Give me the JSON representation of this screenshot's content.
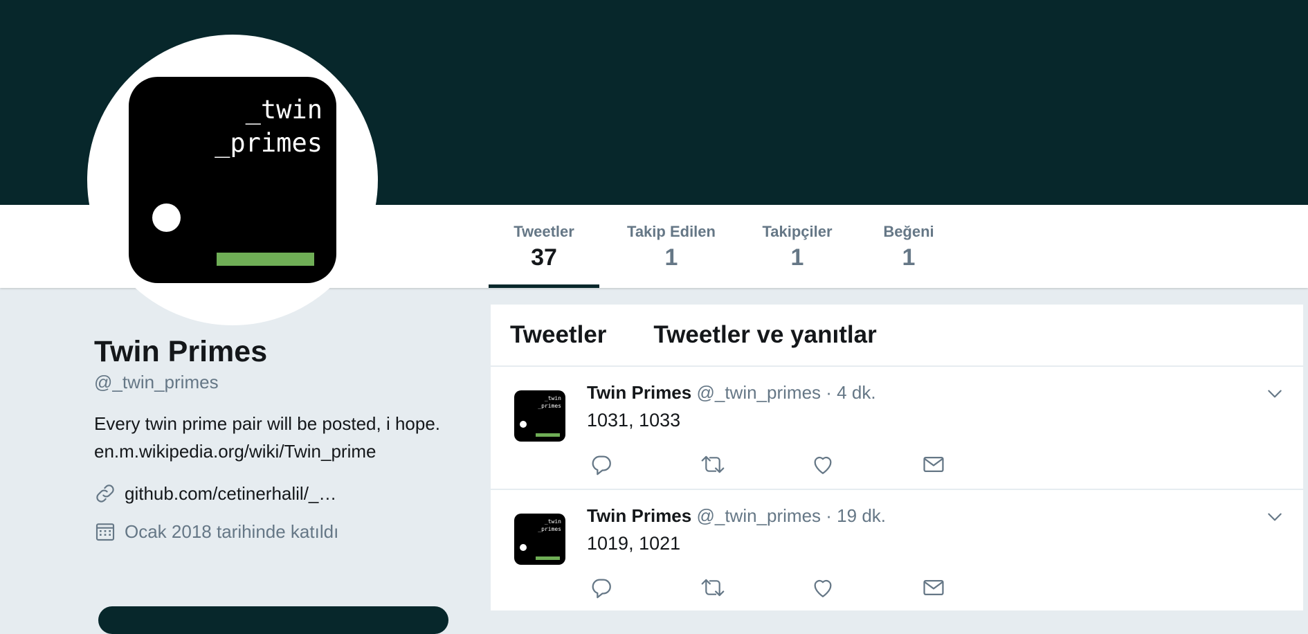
{
  "profile": {
    "name": "Twin Primes",
    "handle": "@_twin_primes",
    "bio": "Every twin prime pair will be posted, i hope.",
    "bio_link": "en.m.wikipedia.org/wiki/Twin_prime",
    "website": "github.com/cetinerhalil/_…",
    "joined": "Ocak 2018 tarihinde katıldı",
    "avatar_text": "_twin\n_primes"
  },
  "stats": [
    {
      "label": "Tweetler",
      "value": "37"
    },
    {
      "label": "Takip Edilen",
      "value": "1"
    },
    {
      "label": "Takipçiler",
      "value": "1"
    },
    {
      "label": "Beğeni",
      "value": "1"
    }
  ],
  "tabs": [
    {
      "label": "Tweetler"
    },
    {
      "label": "Tweetler ve yanıtlar"
    }
  ],
  "tweets": [
    {
      "name": "Twin Primes",
      "handle": "@_twin_primes",
      "sep": "·",
      "time": "4 dk.",
      "text": "1031, 1033"
    },
    {
      "name": "Twin Primes",
      "handle": "@_twin_primes",
      "sep": "·",
      "time": "19 dk.",
      "text": "1019, 1021"
    }
  ],
  "colors": {
    "banner": "#07272b",
    "accent_green": "#6fae56",
    "secondary_text": "#657786",
    "page_background": "#e6ecf0"
  },
  "icons": {
    "website": "link-icon",
    "joined": "calendar-icon",
    "tweet_actions": [
      "reply-icon",
      "retweet-icon",
      "like-icon",
      "direct-message-icon"
    ],
    "tweet_menu": "chevron-down-icon"
  }
}
